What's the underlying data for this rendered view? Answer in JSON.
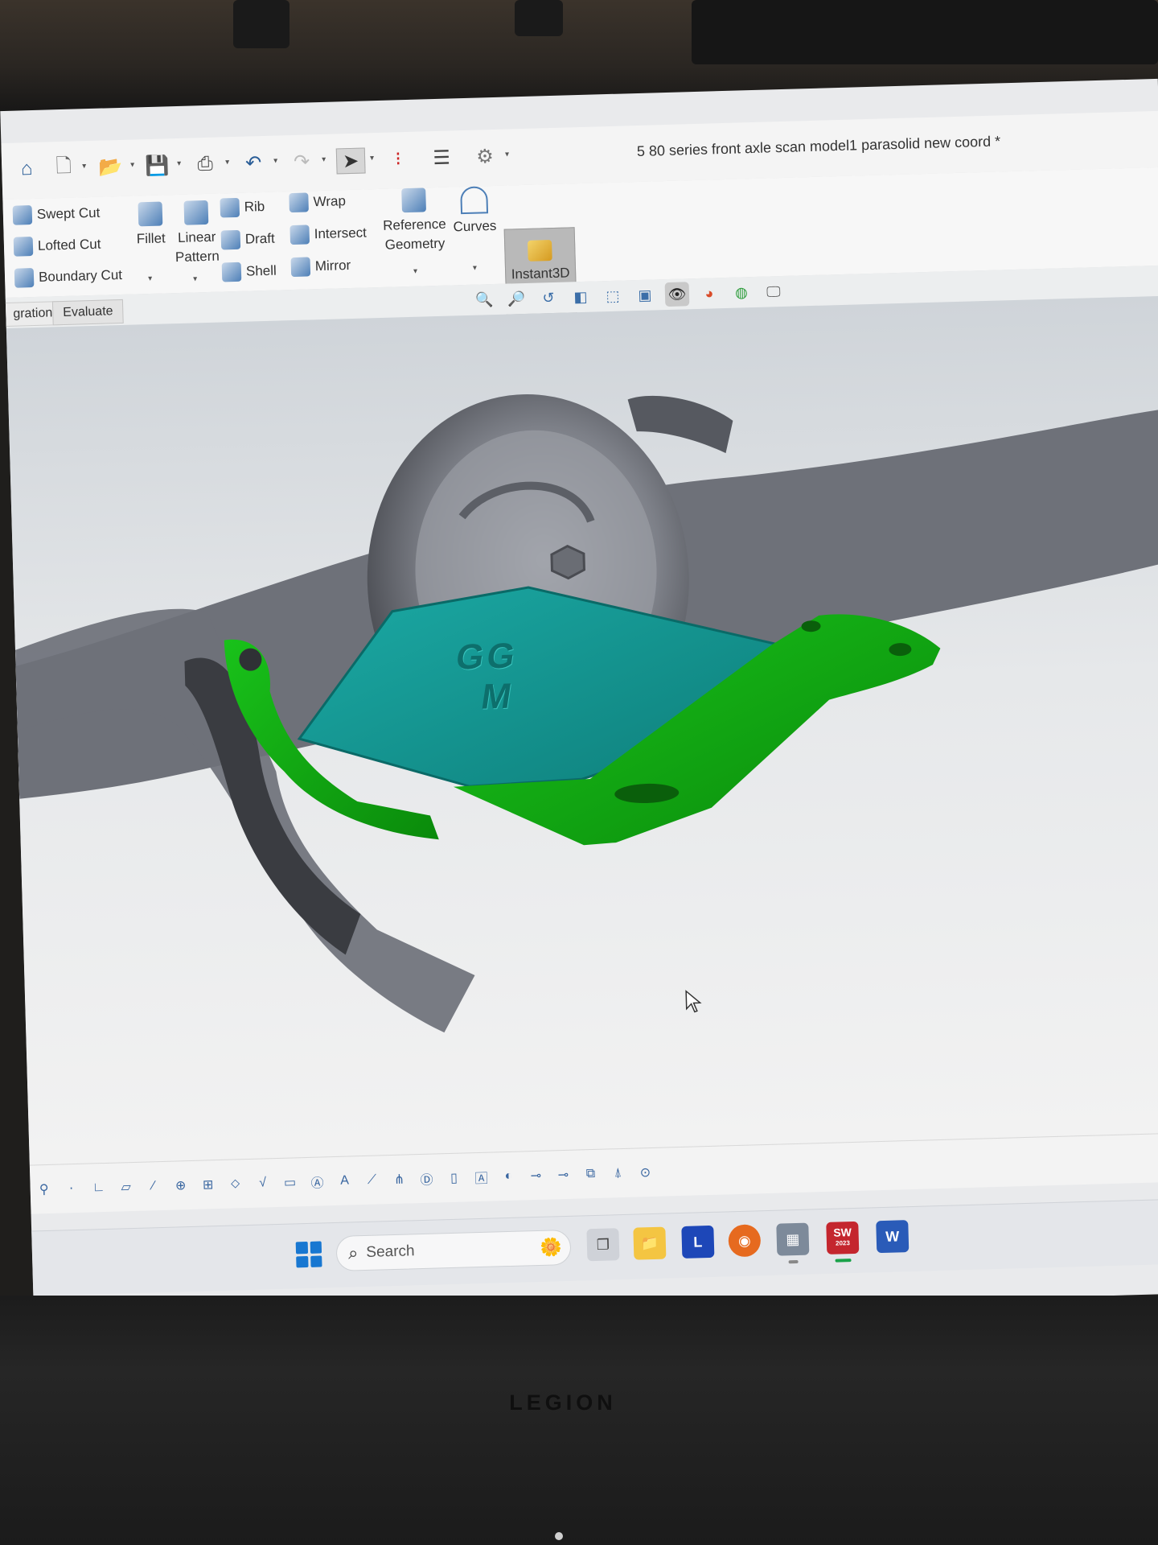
{
  "window": {
    "title": "5 80 series front axle scan model1 parasolid new coord *"
  },
  "ribbon": {
    "cut_items": [
      "Swept Cut",
      "Lofted Cut",
      "Boundary Cut"
    ],
    "fillet_label": "Fillet",
    "linear_pattern_label": [
      "Linear",
      "Pattern"
    ],
    "feature_col1": [
      "Rib",
      "Draft",
      "Shell"
    ],
    "feature_col2": [
      "Wrap",
      "Intersect",
      "Mirror"
    ],
    "reference_geometry_label": [
      "Reference",
      "Geometry"
    ],
    "curves_label": "Curves",
    "instant3d_label": "Instant3D"
  },
  "tabs": [
    "gration",
    "Evaluate"
  ],
  "model": {
    "engraving": [
      "GG",
      "M"
    ],
    "colors": {
      "plate": "#149a96",
      "bracket": "#0fa210",
      "scan": "#6e7179"
    }
  },
  "taskbar": {
    "search_placeholder": "Search",
    "apps": [
      {
        "name": "task-view",
        "glyph": "❐"
      },
      {
        "name": "file-explorer",
        "glyph": "📁"
      },
      {
        "name": "app-l",
        "glyph": "L"
      },
      {
        "name": "firefox",
        "glyph": "◉"
      },
      {
        "name": "calculator",
        "glyph": "▦"
      },
      {
        "name": "solidworks",
        "glyph": "SW",
        "badge": "2023"
      },
      {
        "name": "word",
        "glyph": "W"
      }
    ]
  },
  "bezel": {
    "brand": "LEGION"
  }
}
